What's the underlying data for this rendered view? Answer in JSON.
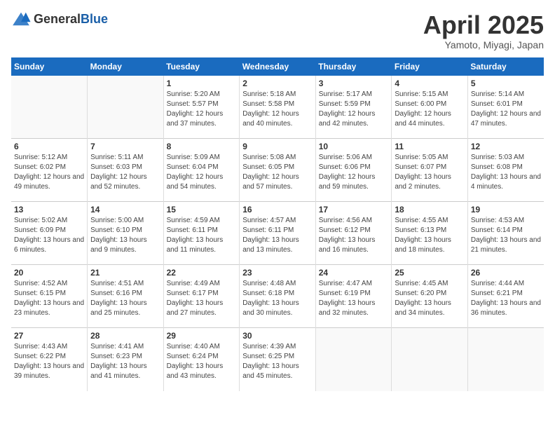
{
  "header": {
    "logo_general": "General",
    "logo_blue": "Blue",
    "month_title": "April 2025",
    "subtitle": "Yamoto, Miyagi, Japan"
  },
  "days_of_week": [
    "Sunday",
    "Monday",
    "Tuesday",
    "Wednesday",
    "Thursday",
    "Friday",
    "Saturday"
  ],
  "weeks": [
    [
      {
        "day": "",
        "info": ""
      },
      {
        "day": "",
        "info": ""
      },
      {
        "day": "1",
        "info": "Sunrise: 5:20 AM\nSunset: 5:57 PM\nDaylight: 12 hours and 37 minutes."
      },
      {
        "day": "2",
        "info": "Sunrise: 5:18 AM\nSunset: 5:58 PM\nDaylight: 12 hours and 40 minutes."
      },
      {
        "day": "3",
        "info": "Sunrise: 5:17 AM\nSunset: 5:59 PM\nDaylight: 12 hours and 42 minutes."
      },
      {
        "day": "4",
        "info": "Sunrise: 5:15 AM\nSunset: 6:00 PM\nDaylight: 12 hours and 44 minutes."
      },
      {
        "day": "5",
        "info": "Sunrise: 5:14 AM\nSunset: 6:01 PM\nDaylight: 12 hours and 47 minutes."
      }
    ],
    [
      {
        "day": "6",
        "info": "Sunrise: 5:12 AM\nSunset: 6:02 PM\nDaylight: 12 hours and 49 minutes."
      },
      {
        "day": "7",
        "info": "Sunrise: 5:11 AM\nSunset: 6:03 PM\nDaylight: 12 hours and 52 minutes."
      },
      {
        "day": "8",
        "info": "Sunrise: 5:09 AM\nSunset: 6:04 PM\nDaylight: 12 hours and 54 minutes."
      },
      {
        "day": "9",
        "info": "Sunrise: 5:08 AM\nSunset: 6:05 PM\nDaylight: 12 hours and 57 minutes."
      },
      {
        "day": "10",
        "info": "Sunrise: 5:06 AM\nSunset: 6:06 PM\nDaylight: 12 hours and 59 minutes."
      },
      {
        "day": "11",
        "info": "Sunrise: 5:05 AM\nSunset: 6:07 PM\nDaylight: 13 hours and 2 minutes."
      },
      {
        "day": "12",
        "info": "Sunrise: 5:03 AM\nSunset: 6:08 PM\nDaylight: 13 hours and 4 minutes."
      }
    ],
    [
      {
        "day": "13",
        "info": "Sunrise: 5:02 AM\nSunset: 6:09 PM\nDaylight: 13 hours and 6 minutes."
      },
      {
        "day": "14",
        "info": "Sunrise: 5:00 AM\nSunset: 6:10 PM\nDaylight: 13 hours and 9 minutes."
      },
      {
        "day": "15",
        "info": "Sunrise: 4:59 AM\nSunset: 6:11 PM\nDaylight: 13 hours and 11 minutes."
      },
      {
        "day": "16",
        "info": "Sunrise: 4:57 AM\nSunset: 6:11 PM\nDaylight: 13 hours and 13 minutes."
      },
      {
        "day": "17",
        "info": "Sunrise: 4:56 AM\nSunset: 6:12 PM\nDaylight: 13 hours and 16 minutes."
      },
      {
        "day": "18",
        "info": "Sunrise: 4:55 AM\nSunset: 6:13 PM\nDaylight: 13 hours and 18 minutes."
      },
      {
        "day": "19",
        "info": "Sunrise: 4:53 AM\nSunset: 6:14 PM\nDaylight: 13 hours and 21 minutes."
      }
    ],
    [
      {
        "day": "20",
        "info": "Sunrise: 4:52 AM\nSunset: 6:15 PM\nDaylight: 13 hours and 23 minutes."
      },
      {
        "day": "21",
        "info": "Sunrise: 4:51 AM\nSunset: 6:16 PM\nDaylight: 13 hours and 25 minutes."
      },
      {
        "day": "22",
        "info": "Sunrise: 4:49 AM\nSunset: 6:17 PM\nDaylight: 13 hours and 27 minutes."
      },
      {
        "day": "23",
        "info": "Sunrise: 4:48 AM\nSunset: 6:18 PM\nDaylight: 13 hours and 30 minutes."
      },
      {
        "day": "24",
        "info": "Sunrise: 4:47 AM\nSunset: 6:19 PM\nDaylight: 13 hours and 32 minutes."
      },
      {
        "day": "25",
        "info": "Sunrise: 4:45 AM\nSunset: 6:20 PM\nDaylight: 13 hours and 34 minutes."
      },
      {
        "day": "26",
        "info": "Sunrise: 4:44 AM\nSunset: 6:21 PM\nDaylight: 13 hours and 36 minutes."
      }
    ],
    [
      {
        "day": "27",
        "info": "Sunrise: 4:43 AM\nSunset: 6:22 PM\nDaylight: 13 hours and 39 minutes."
      },
      {
        "day": "28",
        "info": "Sunrise: 4:41 AM\nSunset: 6:23 PM\nDaylight: 13 hours and 41 minutes."
      },
      {
        "day": "29",
        "info": "Sunrise: 4:40 AM\nSunset: 6:24 PM\nDaylight: 13 hours and 43 minutes."
      },
      {
        "day": "30",
        "info": "Sunrise: 4:39 AM\nSunset: 6:25 PM\nDaylight: 13 hours and 45 minutes."
      },
      {
        "day": "",
        "info": ""
      },
      {
        "day": "",
        "info": ""
      },
      {
        "day": "",
        "info": ""
      }
    ]
  ]
}
